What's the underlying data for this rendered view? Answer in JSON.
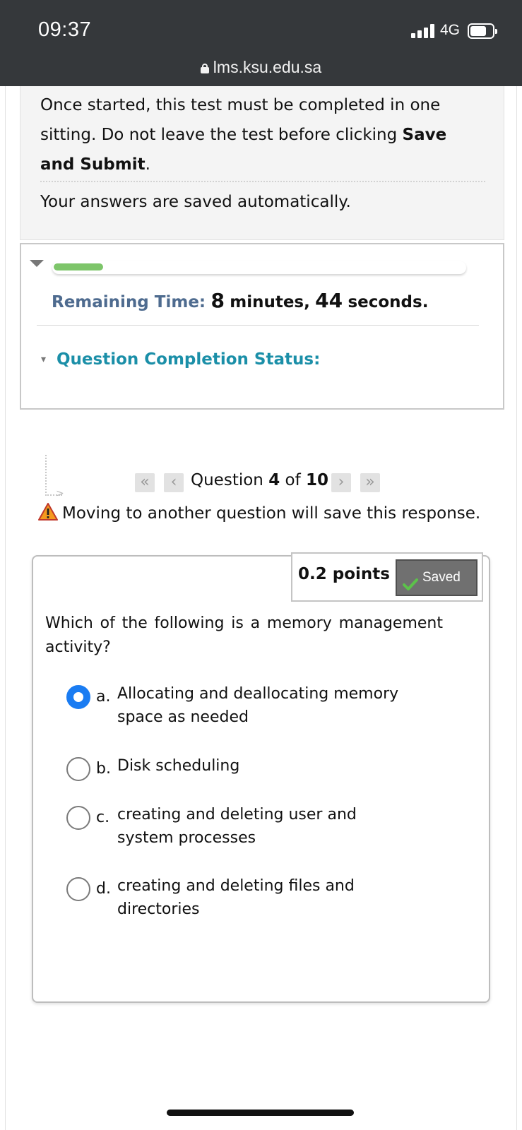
{
  "status_bar": {
    "time": "09:37",
    "network": "4G",
    "url": "lms.ksu.edu.sa"
  },
  "instructions": {
    "part1": "Once started, this test must be completed in one sitting. Do not leave the test before clicking ",
    "bold": "Save and Submit",
    "part2": ".",
    "autosave": "Your answers are saved automatically."
  },
  "timer": {
    "progress_fraction": 0.12,
    "label": "Remaining Time:",
    "minutes": "8",
    "minutes_unit": "minutes,",
    "seconds": "44",
    "seconds_unit": "seconds."
  },
  "completion_status": {
    "label": "Question Completion Status:"
  },
  "navigation": {
    "first_icon": "double-left-chevron",
    "prev_icon": "left-chevron",
    "next_icon": "right-chevron",
    "last_icon": "double-right-chevron",
    "question_word": "Question",
    "current": "4",
    "of_word": "of",
    "total": "10",
    "warning": "Moving to another question will save this response."
  },
  "question": {
    "points": "0.2 points",
    "saved_label": "Saved",
    "text": "Which of the following is a memory management activity?",
    "options": [
      {
        "letter": "a.",
        "text": "Allocating and deallocating memory space as needed",
        "selected": true
      },
      {
        "letter": "b.",
        "text": "Disk scheduling",
        "selected": false
      },
      {
        "letter": "c.",
        "text": "creating and deleting user and system processes",
        "selected": false
      },
      {
        "letter": "d.",
        "text": "creating and deleting files and directories",
        "selected": false
      }
    ]
  },
  "colors": {
    "status_bar": "#35383b",
    "timer_label": "#4e6b8f",
    "completion_status": "#1b8fa8",
    "progress": "#7dc56a",
    "radio_selected": "#1a7cf2",
    "saved_badge": "#707070"
  }
}
